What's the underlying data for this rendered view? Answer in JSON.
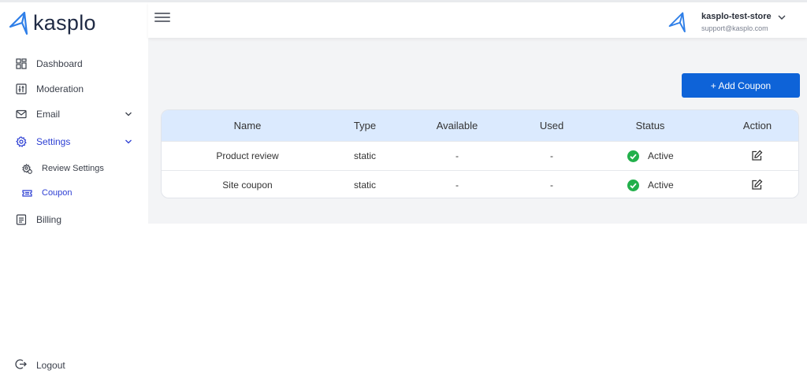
{
  "brand": {
    "name": "kasplo",
    "color": "#2f7fe8"
  },
  "sidebar": {
    "items": [
      {
        "label": "Dashboard",
        "icon": "dashboard-icon"
      },
      {
        "label": "Moderation",
        "icon": "moderation-icon"
      },
      {
        "label": "Email",
        "icon": "mail-icon",
        "expandable": true
      },
      {
        "label": "Settings",
        "icon": "gear-icon",
        "expandable": true,
        "active": true
      },
      {
        "label": "Billing",
        "icon": "billing-icon"
      }
    ],
    "settings_sub": [
      {
        "label": "Review Settings",
        "icon": "review-settings-icon"
      },
      {
        "label": "Coupon",
        "icon": "coupon-icon",
        "active": true
      }
    ],
    "logout_label": "Logout",
    "active_color": "#2c3ed3"
  },
  "header": {
    "store_name": "kasplo-test-store",
    "store_email": "support@kasplo.com"
  },
  "main": {
    "add_button_label": "+ Add Coupon",
    "accent_color": "#0e63d8",
    "table": {
      "columns": [
        "Name",
        "Type",
        "Available",
        "Used",
        "Status",
        "Action"
      ],
      "rows": [
        {
          "name": "Product review",
          "type": "static",
          "available": "-",
          "used": "-",
          "status": "Active"
        },
        {
          "name": "Site coupon",
          "type": "static",
          "available": "-",
          "used": "-",
          "status": "Active"
        }
      ],
      "status_color": "#22b04b"
    }
  }
}
